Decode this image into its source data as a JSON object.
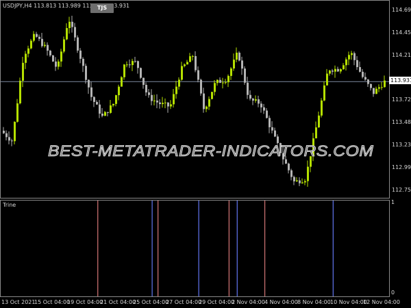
{
  "header": {
    "symbol_line": "USDJPY,H4  113.813 113.989 113.802 113.931",
    "button": "TJS"
  },
  "watermark": "BEST-METATRADER-INDICATORS.COM",
  "price_axis": {
    "labels": [
      "114.695",
      "114.450",
      "114.210",
      "113.725",
      "113.480",
      "113.235",
      "112.995",
      "112.750"
    ],
    "current": "113.931"
  },
  "indicator": {
    "name": "Trine",
    "scale_top": "1",
    "scale_bottom": "0"
  },
  "time_axis": [
    "13 Oct 2021",
    "15 Oct 04:00",
    "19 Oct 04:00",
    "21 Oct 04:00",
    "25 Oct 04:00",
    "27 Oct 04:00",
    "29 Oct 04:00",
    "2 Nov 04:00",
    "4 Nov 04:00",
    "8 Nov 04:00",
    "10 Nov 04:00",
    "12 Nov 04:00"
  ],
  "colors": {
    "bull": "#b5e000",
    "bear": "#b4b4b4",
    "signal_red": "#c87070",
    "signal_blue": "#5b6ee0",
    "price_line": "#7d8aa0"
  },
  "chart_data": {
    "type": "candlestick",
    "ylim": [
      112.75,
      114.695
    ],
    "price_path": [
      113.401,
      113.29,
      114.214,
      114.436,
      114.288,
      114.066,
      114.621,
      114.214,
      113.771,
      113.549,
      113.697,
      114.14,
      114.14,
      113.771,
      113.697,
      113.66,
      114.066,
      114.214,
      113.623,
      113.919,
      113.956,
      114.251,
      113.734,
      113.697,
      113.401,
      113.105,
      112.846,
      112.883,
      113.475,
      114.066,
      114.066,
      114.251,
      113.992,
      113.808,
      113.931
    ],
    "signals": [
      {
        "bar_fraction": 0.25,
        "color": "red"
      },
      {
        "bar_fraction": 0.39,
        "color": "blue"
      },
      {
        "bar_fraction": 0.405,
        "color": "red"
      },
      {
        "bar_fraction": 0.51,
        "color": "blue"
      },
      {
        "bar_fraction": 0.588,
        "color": "red"
      },
      {
        "bar_fraction": 0.609,
        "color": "blue"
      },
      {
        "bar_fraction": 0.68,
        "color": "red"
      },
      {
        "bar_fraction": 0.856,
        "color": "blue"
      }
    ]
  }
}
